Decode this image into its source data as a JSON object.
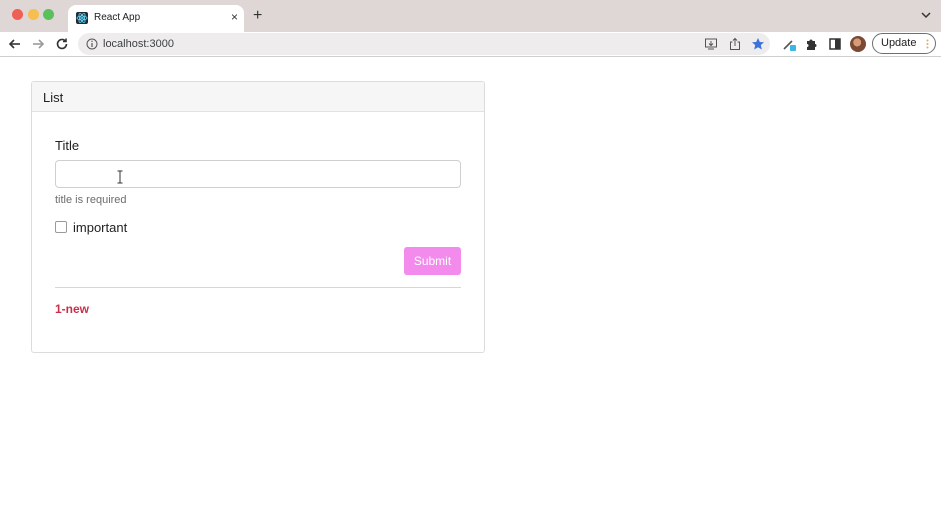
{
  "browser": {
    "tab_title": "React App",
    "tab_close": "×",
    "new_tab": "+",
    "url": "localhost:3000",
    "update_label": "Update"
  },
  "card": {
    "header": "List",
    "form": {
      "title_label": "Title",
      "title_value": "",
      "error": "title is required",
      "important_label": "important",
      "important_checked": false,
      "submit_label": "Submit"
    },
    "items": [
      "1-new"
    ]
  },
  "colors": {
    "submit": "#f28bec",
    "item_text": "#c8304a",
    "header_bg": "#f6f6f6"
  }
}
